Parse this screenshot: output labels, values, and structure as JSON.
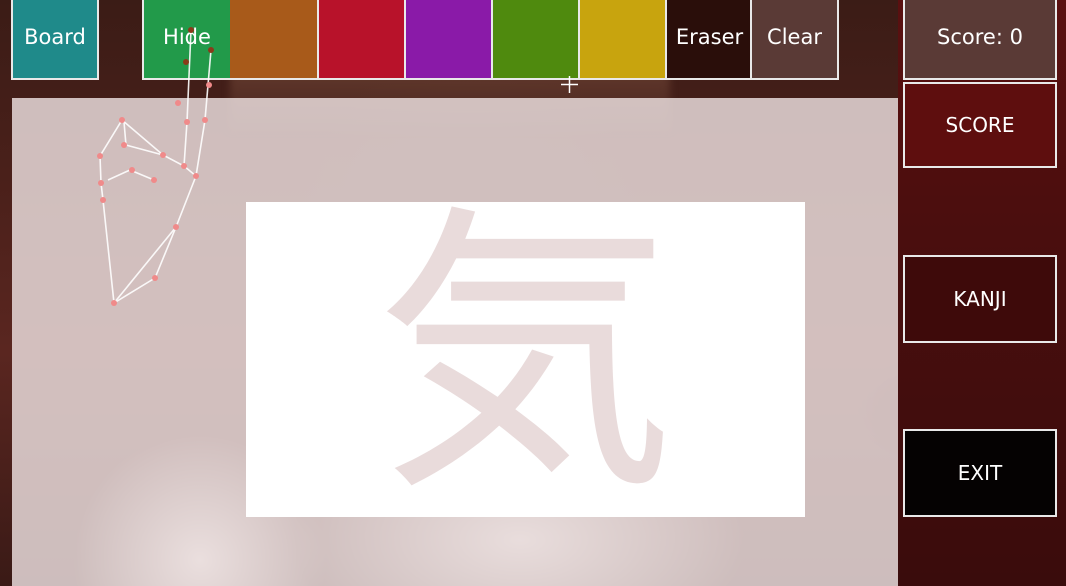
{
  "toolbar": {
    "board_label": "Board",
    "hide_label": "Hide",
    "eraser_label": "Eraser",
    "clear_label": "Clear",
    "colors": [
      "#229a4a",
      "#a85a1a",
      "#b8122a",
      "#8a1aa8",
      "#4f8a0e",
      "#c8a40e"
    ],
    "board_color": "#1f8a8a",
    "eraser_color": "#2a0e0a",
    "clear_color": "#5a3a36"
  },
  "sidebar": {
    "score_label": "Score: 0",
    "score_button": "SCORE",
    "kanji_button": "KANJI",
    "exit_button": "EXIT"
  },
  "canvas": {
    "kanji": "気"
  }
}
